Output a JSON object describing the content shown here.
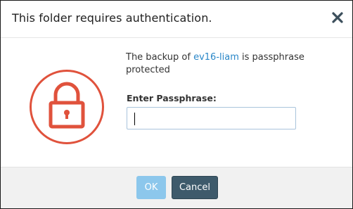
{
  "dialog": {
    "title": "This folder requires authentication.",
    "close_icon": "close-icon"
  },
  "content": {
    "lock_icon": "lock-icon",
    "accent_color": "#e0523c",
    "message_prefix": "The backup of ",
    "message_link": "ev16-liam",
    "message_suffix": " is passphrase protected",
    "passphrase_label": "Enter Passphrase:",
    "passphrase_value": ""
  },
  "footer": {
    "ok_label": "OK",
    "cancel_label": "Cancel"
  }
}
